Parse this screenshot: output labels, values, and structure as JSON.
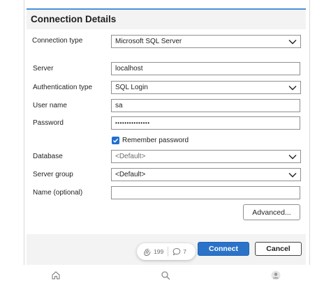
{
  "dialog": {
    "title": "Connection Details",
    "connection_type": {
      "label": "Connection type",
      "value": "Microsoft SQL Server"
    },
    "server": {
      "label": "Server",
      "value": "localhost"
    },
    "authentication_type": {
      "label": "Authentication type",
      "value": "SQL Login"
    },
    "user_name": {
      "label": "User name",
      "value": "sa"
    },
    "password": {
      "label": "Password",
      "value": "•••••••••••••••"
    },
    "remember_password": {
      "label": "Remember password",
      "checked": true
    },
    "database": {
      "label": "Database",
      "value": "<Default>"
    },
    "server_group": {
      "label": "Server group",
      "value": "<Default>"
    },
    "name_optional": {
      "label": "Name (optional)",
      "value": ""
    },
    "advanced_label": "Advanced...",
    "connect_label": "Connect",
    "cancel_label": "Cancel"
  },
  "reactions": {
    "claps": "199",
    "comments": "7"
  },
  "bottom_nav": {
    "icons": [
      "home-icon",
      "search-icon",
      "profile-icon"
    ]
  },
  "colors": {
    "accent": "#2a73c8",
    "header_bg": "#f3f3f3",
    "top_accent": "#4a8fd8"
  }
}
